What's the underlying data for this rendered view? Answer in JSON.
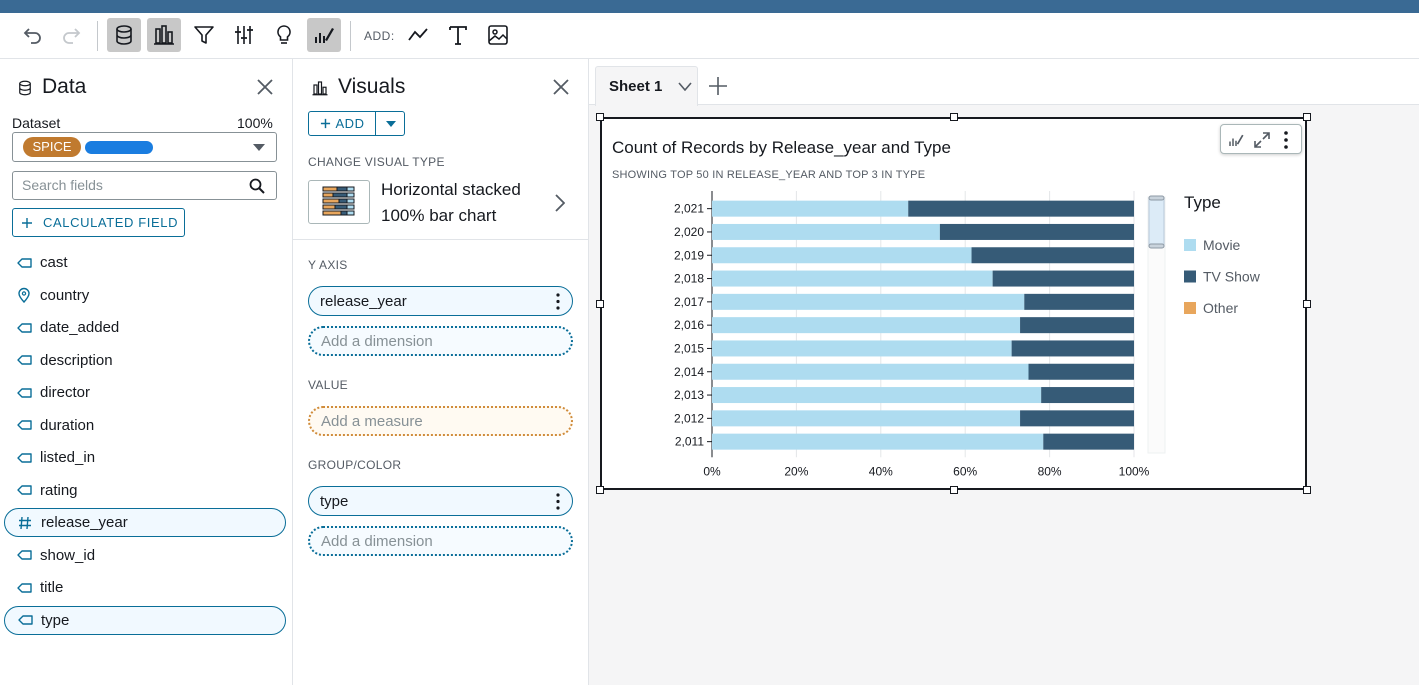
{
  "toolbar": {
    "add_label": "ADD:",
    "buttons": [
      "undo-icon",
      "redo-icon",
      "dataset-icon",
      "visualize-icon",
      "filter-icon",
      "parameters-icon",
      "insights-icon",
      "format-visual-icon",
      "add-line-icon",
      "add-text-icon",
      "add-image-icon"
    ]
  },
  "data_panel": {
    "title": "Data",
    "dataset_label": "Dataset",
    "dataset_percent": "100%",
    "spice_label": "SPICE",
    "search_placeholder": "Search fields",
    "calculated_field_label": "CALCULATED FIELD",
    "fields": [
      {
        "name": "cast",
        "icon": "dimension-tag-icon"
      },
      {
        "name": "country",
        "icon": "location-pin-icon"
      },
      {
        "name": "date_added",
        "icon": "dimension-tag-icon"
      },
      {
        "name": "description",
        "icon": "dimension-tag-icon"
      },
      {
        "name": "director",
        "icon": "dimension-tag-icon"
      },
      {
        "name": "duration",
        "icon": "dimension-tag-icon"
      },
      {
        "name": "listed_in",
        "icon": "dimension-tag-icon"
      },
      {
        "name": "rating",
        "icon": "dimension-tag-icon"
      },
      {
        "name": "release_year",
        "icon": "numeric-hash-icon",
        "selected": true
      },
      {
        "name": "show_id",
        "icon": "dimension-tag-icon"
      },
      {
        "name": "title",
        "icon": "dimension-tag-icon"
      },
      {
        "name": "type",
        "icon": "dimension-tag-icon",
        "selected": true
      }
    ]
  },
  "visuals_panel": {
    "title": "Visuals",
    "add_label": "ADD",
    "change_visual_type_label": "CHANGE VISUAL TYPE",
    "visual_type_line1": "Horizontal stacked",
    "visual_type_line2": "100% bar chart",
    "y_axis_label": "Y AXIS",
    "y_axis_value": "release_year",
    "y_axis_add": "Add a dimension",
    "value_label": "VALUE",
    "value_add": "Add a measure",
    "group_label": "GROUP/COLOR",
    "group_value": "type",
    "group_add": "Add a dimension"
  },
  "sheet": {
    "tab_name": "Sheet 1"
  },
  "chart_data": {
    "type": "bar",
    "orientation": "horizontal",
    "stacked_percent": true,
    "title": "Count of Records by Release_year and Type",
    "subtitle": "SHOWING TOP 50 IN RELEASE_YEAR AND TOP 3 IN TYPE",
    "categories": [
      "2,021",
      "2,020",
      "2,019",
      "2,018",
      "2,017",
      "2,016",
      "2,015",
      "2,014",
      "2,013",
      "2,012",
      "2,011"
    ],
    "series": [
      {
        "name": "Movie",
        "color": "#aedcf0",
        "values": [
          46.5,
          54,
          61.5,
          66.5,
          74,
          73,
          71,
          75,
          78,
          73,
          78.5
        ]
      },
      {
        "name": "TV Show",
        "color": "#365b77",
        "values": [
          53.5,
          46,
          38.5,
          33.5,
          26,
          27,
          29,
          25,
          22,
          27,
          21.5
        ]
      }
    ],
    "x_ticks": [
      "0%",
      "20%",
      "40%",
      "60%",
      "80%",
      "100%"
    ],
    "xlim": [
      0,
      100
    ],
    "legend": {
      "title": "Type",
      "position": "right",
      "entries": [
        {
          "name": "Movie",
          "color": "#aedcf0"
        },
        {
          "name": "TV Show",
          "color": "#365b77"
        },
        {
          "name": "Other",
          "color": "#e8a65c"
        }
      ]
    },
    "grid": true
  }
}
